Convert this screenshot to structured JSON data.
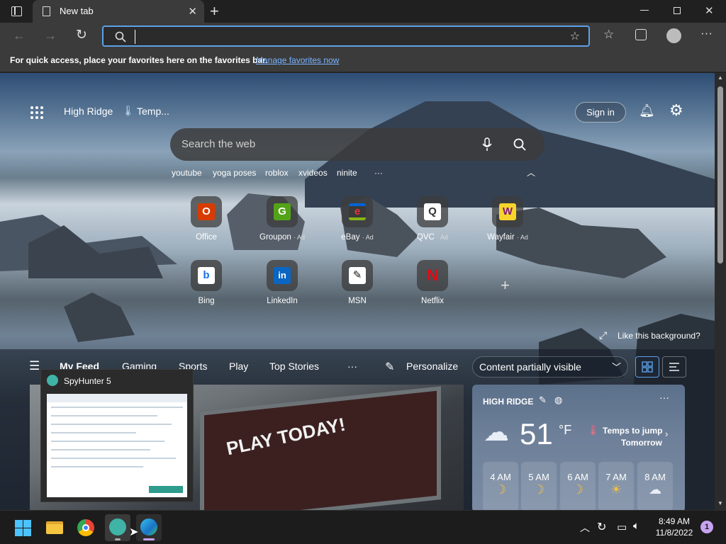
{
  "browser": {
    "tab_title": "New tab",
    "address_value": "",
    "favorites_bar_message": "For quick access, place your favorites here on the favorites bar.",
    "favorites_bar_link": "Manage favorites now"
  },
  "newtab": {
    "location": "High Ridge",
    "temp_label": "Temp...",
    "sign_in": "Sign in",
    "search_placeholder": "Search the web",
    "quick_searches": [
      "youtube",
      "yoga poses",
      "roblox",
      "xvideos",
      "ninite"
    ],
    "more_label": "···",
    "tiles": [
      {
        "label": "Office",
        "ad": "",
        "icon": "office-icon",
        "color": "#d83b01",
        "glyph": "O"
      },
      {
        "label": "Groupon",
        "ad": "· Ad",
        "icon": "groupon-icon",
        "color": "#53a318",
        "glyph": "G"
      },
      {
        "label": "eBay",
        "ad": "· Ad",
        "icon": "ebay-icon",
        "color": "#e53238",
        "glyph": "e"
      },
      {
        "label": "QVC",
        "ad": "· Ad",
        "icon": "qvc-icon",
        "color": "#ffffff",
        "glyph": "Q"
      },
      {
        "label": "Wayfair",
        "ad": "· Ad",
        "icon": "wayfair-icon",
        "color": "#7f187f",
        "glyph": "W"
      },
      {
        "label": "Bing",
        "ad": "",
        "icon": "bing-icon",
        "color": "#ffffff",
        "glyph": "b"
      },
      {
        "label": "LinkedIn",
        "ad": "",
        "icon": "linkedin-icon",
        "color": "#0a66c2",
        "glyph": "in"
      },
      {
        "label": "MSN",
        "ad": "",
        "icon": "msn-icon",
        "color": "#ffffff",
        "glyph": "❄"
      },
      {
        "label": "Netflix",
        "ad": "",
        "icon": "netflix-icon",
        "color": "#e50914",
        "glyph": "N"
      }
    ],
    "like_background": "Like this background?",
    "feed_tabs": [
      "My Feed",
      "Gaming",
      "Sports",
      "Play",
      "Top Stories"
    ],
    "personalize": "Personalize",
    "content_visibility": "Content partially visible",
    "article_text": "PLAY TODAY!"
  },
  "weather": {
    "location": "HIGH RIDGE",
    "temperature": "51",
    "unit": "°F",
    "alert_line1": "Temps to jump",
    "alert_line2": "Tomorrow",
    "hours": [
      "4 AM",
      "5 AM",
      "6 AM",
      "7 AM",
      "8 AM"
    ]
  },
  "preview": {
    "app_title": "SpyHunter 5"
  },
  "taskbar": {
    "time": "8:49 AM",
    "date": "11/8/2022",
    "notifications": "1"
  }
}
